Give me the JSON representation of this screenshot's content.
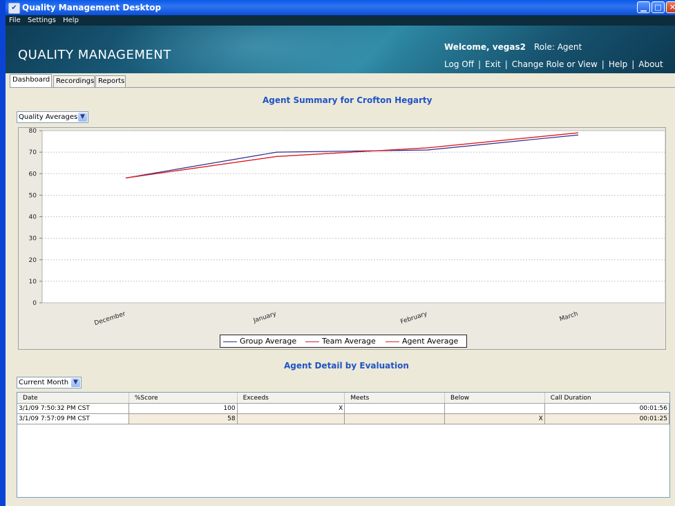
{
  "window": {
    "title": "Quality Management Desktop"
  },
  "menu": [
    "File",
    "Settings",
    "Help"
  ],
  "header": {
    "logo": "QUALITY MANAGEMENT",
    "welcome": "Welcome, vegas2",
    "role": "Role: Agent",
    "links": [
      "Log Off",
      "Exit",
      "Change Role or View",
      "Help",
      "About"
    ]
  },
  "tabs": [
    "Dashboard",
    "Recordings",
    "Reports"
  ],
  "summary": {
    "title": "Agent Summary for Crofton Hegarty",
    "selector": "Quality Averages"
  },
  "chart_data": {
    "type": "line",
    "categories": [
      "December",
      "January",
      "February",
      "March"
    ],
    "series": [
      {
        "name": "Group Average",
        "values": [
          58,
          70,
          71,
          78
        ],
        "color": "#2a2a8a"
      },
      {
        "name": "Team Average",
        "values": [
          58,
          68,
          72,
          79
        ],
        "color": "#c0204a"
      },
      {
        "name": "Agent Average",
        "values": [
          58,
          68,
          72,
          79
        ],
        "color": "#e02020"
      }
    ],
    "ylim": [
      0,
      80
    ],
    "yticks": [
      0,
      10,
      20,
      30,
      40,
      50,
      60,
      70,
      80
    ],
    "grid": true,
    "legend": "bottom"
  },
  "detail": {
    "title": "Agent Detail by Evaluation",
    "selector": "Current Month",
    "columns": [
      "Date",
      "%Score",
      "Exceeds",
      "Meets",
      "Below",
      "Call Duration"
    ],
    "rows": [
      [
        "3/1/09 7:50:32 PM CST",
        "100",
        "X",
        "",
        "",
        "00:01:56"
      ],
      [
        "3/1/09 7:57:09 PM CST",
        "58",
        "",
        "",
        "X",
        "00:01:25"
      ]
    ]
  },
  "icons": {
    "minimize": "minimize-icon",
    "maximize": "maximize-icon",
    "close": "close-icon",
    "dropdown": "chevron-down-icon"
  }
}
